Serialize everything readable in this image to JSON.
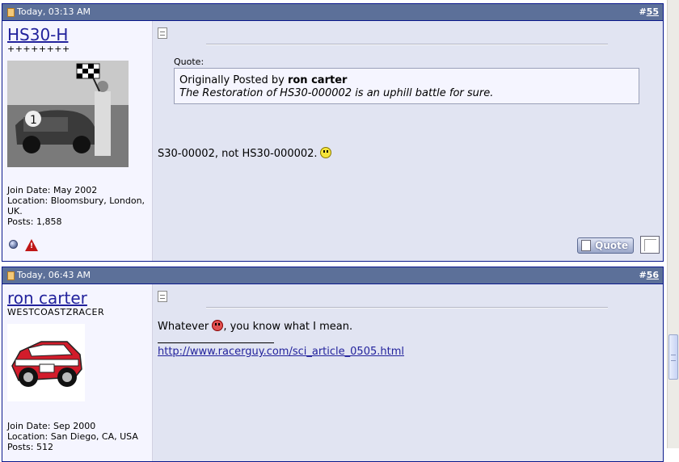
{
  "posts": [
    {
      "date": "Today, 03:13 AM",
      "number_prefix": "#",
      "number": "55",
      "username": "HS30-H",
      "user_title": "++++++++",
      "join_date": "Join Date: May 2002",
      "location": "Location: Bloomsbury, London, UK.",
      "posts": "Posts: 1,858",
      "quote_label": "Quote:",
      "quote_prefix": "Originally Posted by ",
      "quote_author": "ron carter",
      "quote_text": "The Restoration of HS30-000002 is an uphill battle for sure.",
      "message": "S30-00002, not HS30-000002.",
      "smiley": "smile-icon",
      "quote_button": "Quote"
    },
    {
      "date": "Today, 06:43 AM",
      "number_prefix": "#",
      "number": "56",
      "username": "ron carter",
      "user_title": "WESTCOASTZRACER",
      "join_date": "Join Date: Sep 2000",
      "location": "Location: San Diego, CA, USA",
      "posts": "Posts: 512",
      "message_before": "Whatever ",
      "message_after": ", you know what I mean.",
      "smiley": "mad-icon",
      "signature_link": "http://www.racerguy.com/sci_article_0505.html"
    }
  ],
  "colors": {
    "header": "#5c7099",
    "border": "#0b198c",
    "message_bg": "#e1e4f2",
    "user_bg": "#f5f5ff",
    "link": "#22229c"
  }
}
